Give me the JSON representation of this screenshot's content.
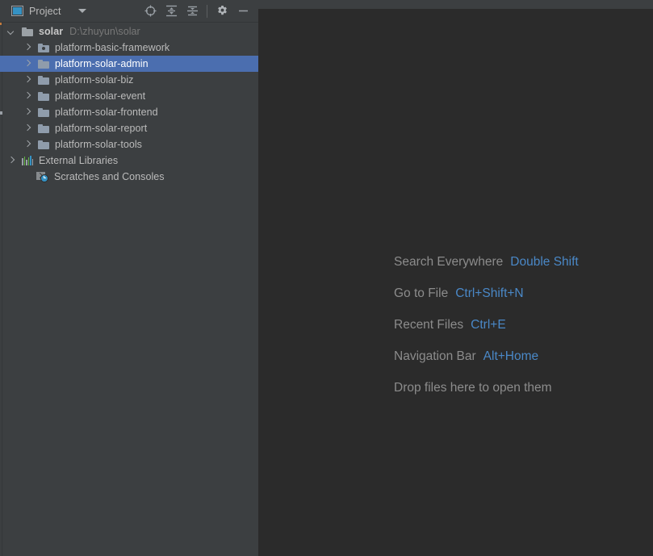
{
  "toolwindow": {
    "title": "Project",
    "icon": "project-icon",
    "dropdown_icon": "chevron-down-icon",
    "actions": [
      {
        "name": "select-opened-file-button",
        "icon": "crosshair-target-icon",
        "tooltip": "Select Opened File"
      },
      {
        "name": "expand-all-button",
        "icon": "expand-all-icon",
        "tooltip": "Expand All"
      },
      {
        "name": "collapse-all-button",
        "icon": "collapse-all-icon",
        "tooltip": "Collapse All"
      },
      {
        "name": "settings-button",
        "icon": "gear-icon",
        "tooltip": "Settings"
      },
      {
        "name": "hide-button",
        "icon": "minimize-icon",
        "tooltip": "Hide"
      }
    ]
  },
  "tree": {
    "rows": [
      {
        "label": "solar",
        "secondary": "D:\\zhuyun\\solar",
        "indent": 10,
        "arrow": "down",
        "icon": "folder-icon-grey",
        "bold": true,
        "selected": false
      },
      {
        "label": "platform-basic-framework",
        "secondary": "",
        "indent": 30,
        "arrow": "right",
        "icon": "module-folder-icon",
        "bold": false,
        "selected": false
      },
      {
        "label": "platform-solar-admin",
        "secondary": "",
        "indent": 30,
        "arrow": "right",
        "icon": "folder-icon",
        "bold": false,
        "selected": true
      },
      {
        "label": "platform-solar-biz",
        "secondary": "",
        "indent": 30,
        "arrow": "right",
        "icon": "folder-icon",
        "bold": false,
        "selected": false
      },
      {
        "label": "platform-solar-event",
        "secondary": "",
        "indent": 30,
        "arrow": "right",
        "icon": "folder-icon",
        "bold": false,
        "selected": false
      },
      {
        "label": "platform-solar-frontend",
        "secondary": "",
        "indent": 30,
        "arrow": "right",
        "icon": "folder-icon",
        "bold": false,
        "selected": false
      },
      {
        "label": "platform-solar-report",
        "secondary": "",
        "indent": 30,
        "arrow": "right",
        "icon": "folder-icon",
        "bold": false,
        "selected": false
      },
      {
        "label": "platform-solar-tools",
        "secondary": "",
        "indent": 30,
        "arrow": "right",
        "icon": "folder-icon",
        "bold": false,
        "selected": false
      },
      {
        "label": "External Libraries",
        "secondary": "",
        "indent": 10,
        "arrow": "right",
        "icon": "external-libraries-icon",
        "bold": false,
        "selected": false
      },
      {
        "label": "Scratches and Consoles",
        "secondary": "",
        "indent": 28,
        "arrow": "none",
        "icon": "scratches-consoles-icon",
        "bold": false,
        "selected": false
      }
    ]
  },
  "editor": {
    "hints": [
      {
        "name": "Search Everywhere",
        "key": "Double Shift"
      },
      {
        "name": "Go to File",
        "key": "Ctrl+Shift+N"
      },
      {
        "name": "Recent Files",
        "key": "Ctrl+E"
      },
      {
        "name": "Navigation Bar",
        "key": "Alt+Home"
      },
      {
        "name": "Drop files here to open them",
        "key": ""
      }
    ]
  },
  "colors": {
    "toolwindow_bg": "#3c3f41",
    "editor_bg": "#2b2b2b",
    "selection_bg": "#4b6eaf",
    "text": "#bbbbbb",
    "text_dim": "#787878",
    "hint_name": "#8c8c8c",
    "hint_key": "#4a88c7",
    "folder_icon": "#8f9cab"
  }
}
